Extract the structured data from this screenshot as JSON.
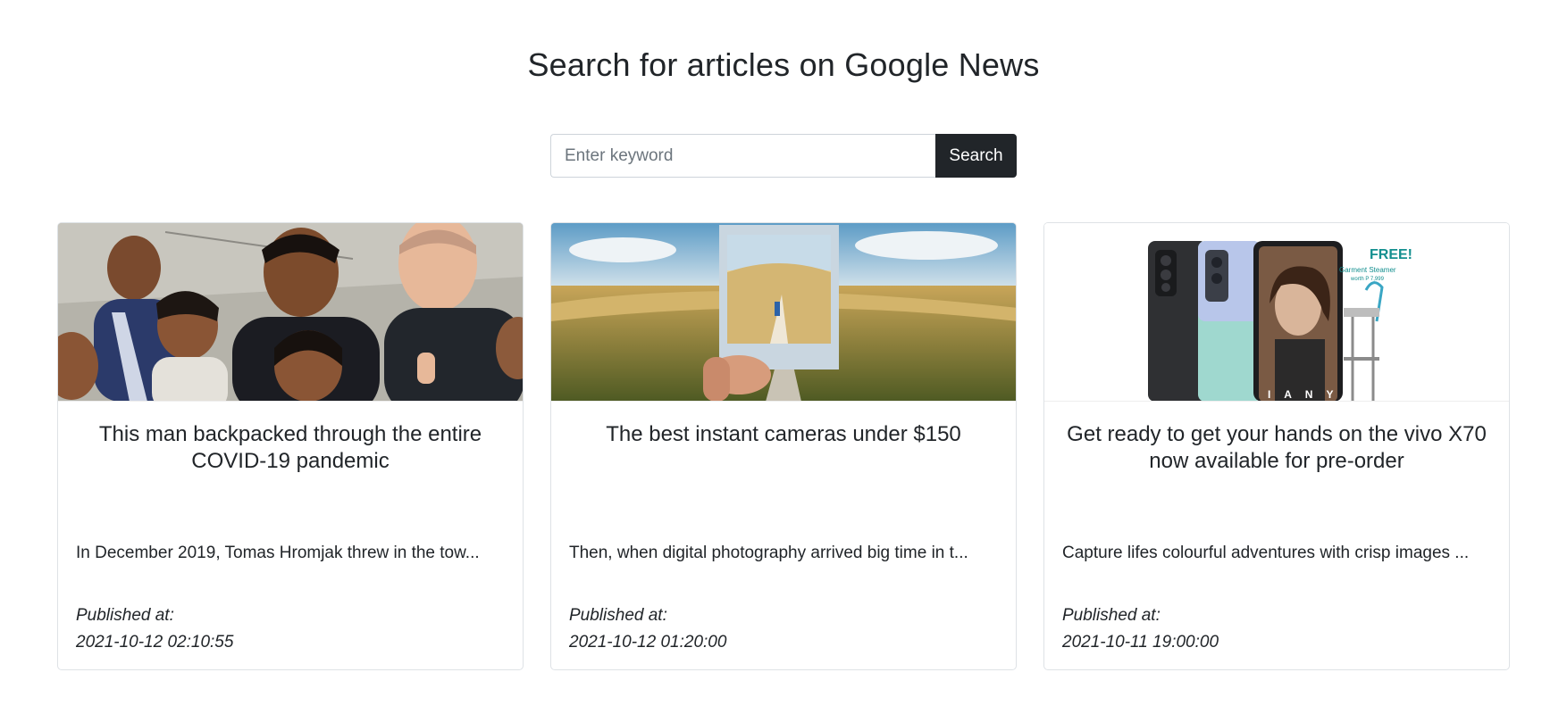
{
  "header": {
    "title": "Search for articles on Google News"
  },
  "search": {
    "placeholder": "Enter keyword",
    "value": "",
    "button_label": "Search"
  },
  "articles": [
    {
      "title": "This man backpacked through the entire COVID-19 pandemic",
      "description": "In December 2019, Tomas Hromjak threw in the tow...",
      "published_label": "Published at:",
      "published_at": "2021-10-12 02:10:55",
      "image": "group-of-smiling-people-photo"
    },
    {
      "title": "The best instant cameras under $150",
      "description": "Then, when digital photography arrived big time in t...",
      "published_label": "Published at:",
      "published_at": "2021-10-12 01:20:00",
      "image": "instant-photo-landscape"
    },
    {
      "title": "Get ready to get your hands on the vivo X70 now available for pre-order",
      "description": "Capture lifes colourful adventures with crisp images ...",
      "published_label": "Published at:",
      "published_at": "2021-10-11 19:00:00",
      "image": "phone-ad",
      "image_text": {
        "free": "FREE!",
        "steamer": "Garment Steamer",
        "worth": "worth P 7,999"
      }
    }
  ],
  "colors": {
    "button_bg": "#212529",
    "border": "#dee2e6",
    "text": "#212529"
  }
}
